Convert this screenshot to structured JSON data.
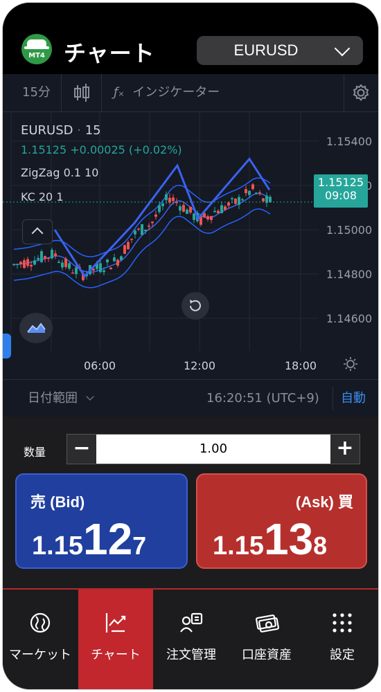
{
  "header": {
    "title": "チャート",
    "symbol": "EURUSD",
    "logo_text": "MT4"
  },
  "toolbar": {
    "timeframe": "15分",
    "indicator_label": "インジケーター"
  },
  "chart": {
    "symbol": "EURUSD",
    "interval": "15",
    "last_price": "1.15125",
    "change": "+0.00025 (+0.02%)",
    "indicators": [
      "ZigZag 0.1 10",
      "KC 20 1"
    ],
    "price_tag": "1.15125",
    "price_tag_time": "09:08",
    "y_ticks": [
      "1.15400",
      "1.15200",
      "1.15000",
      "1.14800",
      "1.14600"
    ],
    "x_ticks": [
      "06:00",
      "12:00",
      "18:00"
    ],
    "colors": {
      "up": "#26a69a",
      "down": "#ef5350",
      "band": "#2962ff",
      "zigzag": "#2f5bea",
      "bg": "#141923"
    }
  },
  "chart_data": {
    "type": "line",
    "title": "EURUSD · 15",
    "x": [
      "06:00",
      "12:00",
      "18:00"
    ],
    "ylim": [
      1.144,
      1.155
    ],
    "series": [
      {
        "name": "EURUSD",
        "values": [
          1.1483,
          1.1508,
          1.15125
        ]
      }
    ]
  },
  "bottombar": {
    "date_range": "日付範囲",
    "time": "16:20:51 (UTC+9)",
    "auto": "自動"
  },
  "trade": {
    "qty_label": "数量",
    "qty_value": "1.00",
    "minus": "−",
    "plus": "+",
    "bid": {
      "label": "売 (Bid)",
      "p1": "1.15",
      "p2": "12",
      "p3": "7"
    },
    "ask": {
      "label": "(Ask) 買",
      "p1": "1.15",
      "p2": "13",
      "p3": "8"
    }
  },
  "nav": [
    {
      "label": "マーケット",
      "icon": "market-icon"
    },
    {
      "label": "チャート",
      "icon": "chart-icon"
    },
    {
      "label": "注文管理",
      "icon": "order-icon"
    },
    {
      "label": "口座資産",
      "icon": "account-icon"
    },
    {
      "label": "設定",
      "icon": "settings-icon"
    }
  ]
}
